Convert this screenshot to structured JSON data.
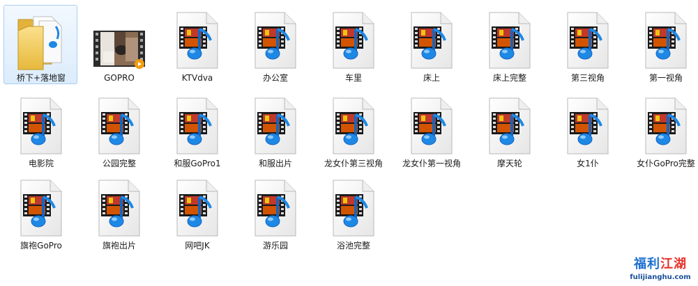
{
  "files": [
    {
      "label": "桥下+落地窗",
      "type": "folder",
      "selected": true
    },
    {
      "label": "GOPRO",
      "type": "video-thumbnail",
      "selected": false
    },
    {
      "label": "KTVdva",
      "type": "media",
      "selected": false
    },
    {
      "label": "办公室",
      "type": "media",
      "selected": false
    },
    {
      "label": "车里",
      "type": "media",
      "selected": false
    },
    {
      "label": "床上",
      "type": "media",
      "selected": false
    },
    {
      "label": "床上完整",
      "type": "media",
      "selected": false
    },
    {
      "label": "第三视角",
      "type": "media",
      "selected": false
    },
    {
      "label": "第一视角",
      "type": "media",
      "selected": false
    },
    {
      "label": "电影院",
      "type": "media",
      "selected": false
    },
    {
      "label": "公园完整",
      "type": "media",
      "selected": false
    },
    {
      "label": "和服GoPro1",
      "type": "media",
      "selected": false
    },
    {
      "label": "和服出片",
      "type": "media",
      "selected": false
    },
    {
      "label": "龙女仆第三视角",
      "type": "media",
      "selected": false
    },
    {
      "label": "龙女仆第一视角",
      "type": "media",
      "selected": false
    },
    {
      "label": "摩天轮",
      "type": "media",
      "selected": false
    },
    {
      "label": "女1仆",
      "type": "media",
      "selected": false
    },
    {
      "label": "女仆GoPro完整",
      "type": "media",
      "selected": false
    },
    {
      "label": "旗袍GoPro",
      "type": "media",
      "selected": false
    },
    {
      "label": "旗袍出片",
      "type": "media",
      "selected": false
    },
    {
      "label": "网吧JK",
      "type": "media",
      "selected": false
    },
    {
      "label": "游乐园",
      "type": "media",
      "selected": false
    },
    {
      "label": "浴池完整",
      "type": "media",
      "selected": false
    }
  ],
  "watermark": {
    "title_part1": "福利",
    "title_part2": "江湖",
    "url": "fulijianghu.com"
  },
  "colors": {
    "selection_bg": "#dcecfc",
    "selection_border": "#a8cff3",
    "note_blue": "#1e88e5",
    "film_strip": "#1b1b1b",
    "watermark_blue": "#1d6fd1",
    "watermark_red": "#e8322d"
  },
  "icons": {
    "folder": "folder-icon",
    "media": "media-file-icon",
    "video-thumbnail": "video-thumbnail-icon"
  }
}
